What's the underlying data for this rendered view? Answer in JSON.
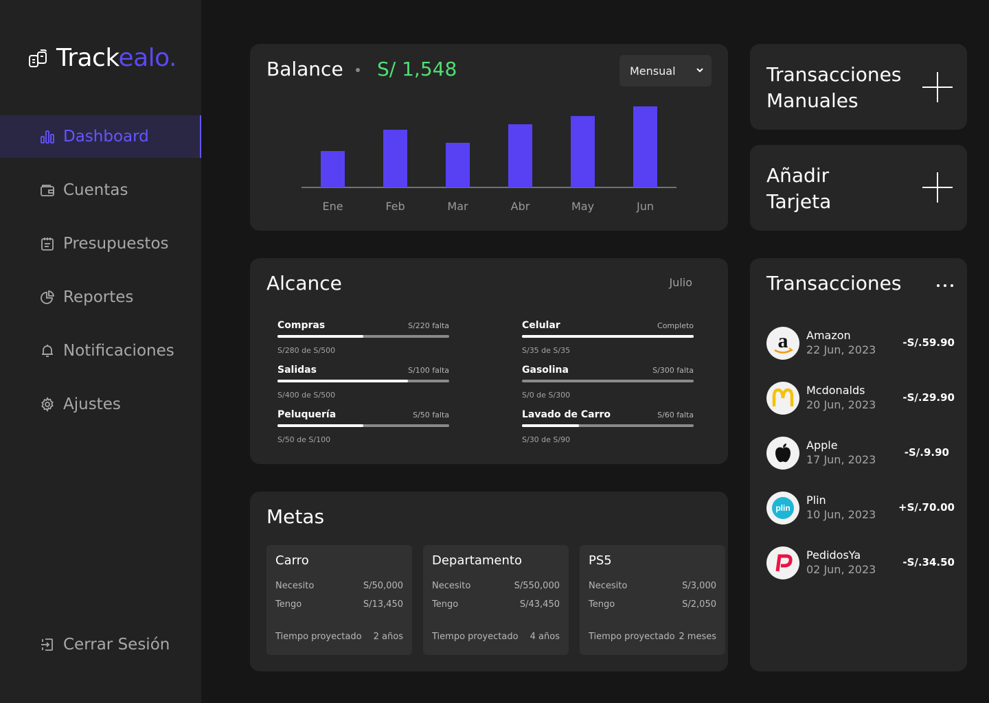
{
  "app": {
    "brand_main": "Track",
    "brand_accent": "ealo."
  },
  "sidebar": {
    "items": [
      {
        "label": "Dashboard",
        "icon": "bar-chart-icon",
        "active": true
      },
      {
        "label": "Cuentas",
        "icon": "wallet-icon",
        "active": false
      },
      {
        "label": "Presupuestos",
        "icon": "notepad-icon",
        "active": false
      },
      {
        "label": "Reportes",
        "icon": "pie-chart-icon",
        "active": false
      },
      {
        "label": "Notificaciones",
        "icon": "bell-icon",
        "active": false
      },
      {
        "label": "Ajustes",
        "icon": "gear-icon",
        "active": false
      }
    ],
    "logout": "Cerrar Sesión"
  },
  "balance": {
    "title": "Balance",
    "value": "S/ 1,548",
    "period": "Mensual"
  },
  "chart_data": {
    "type": "bar",
    "categories": [
      "Ene",
      "Feb",
      "Mar",
      "Abr",
      "May",
      "Jun"
    ],
    "values": [
      53,
      84,
      65,
      92,
      104,
      118
    ],
    "bar_color": "#5741f3",
    "ylim": [
      0,
      130
    ],
    "grid": false
  },
  "alcance": {
    "title": "Alcance",
    "month": "Julio",
    "items": [
      {
        "name": "Compras",
        "remaining": "S/220 falta",
        "detail": "S/280 de S/500",
        "progress": 0.5
      },
      {
        "name": "Celular",
        "remaining": "Completo",
        "detail": "S/35 de S/35",
        "progress": 1.0
      },
      {
        "name": "Salidas",
        "remaining": "S/100 falta",
        "detail": "S/400 de S/500",
        "progress": 0.76
      },
      {
        "name": "Gasolina",
        "remaining": "S/300 falta",
        "detail": "S/0 de S/300",
        "progress": 0.0
      },
      {
        "name": "Peluquería",
        "remaining": "S/50 falta",
        "detail": "S/50 de S/100",
        "progress": 0.5
      },
      {
        "name": "Lavado de Carro",
        "remaining": "S/60 falta",
        "detail": "S/30 de S/90",
        "progress": 0.33
      }
    ]
  },
  "metas": {
    "title": "Metas",
    "need_label": "Necesito",
    "have_label": "Tengo",
    "time_label": "Tiempo proyectado",
    "goals": [
      {
        "name": "Carro",
        "need": "S/50,000",
        "have": "S/13,450",
        "time": "2 años"
      },
      {
        "name": "Departamento",
        "need": "S/550,000",
        "have": "S/43,450",
        "time": "4 años"
      },
      {
        "name": "PS5",
        "need": "S/3,000",
        "have": "S/2,050",
        "time": "2 meses"
      }
    ]
  },
  "actions": {
    "manual_line1": "Transacciones",
    "manual_line2": "Manuales",
    "card_line1": "Añadir",
    "card_line2": "Tarjeta"
  },
  "transactions": {
    "title": "Transacciones",
    "items": [
      {
        "name": "Amazon",
        "date": "22 Jun, 2023",
        "amount": "-S/.59.90",
        "logo": "amazon-logo-icon"
      },
      {
        "name": "Mcdonalds",
        "date": "20 Jun, 2023",
        "amount": "-S/.29.90",
        "logo": "mcdonalds-logo-icon"
      },
      {
        "name": "Apple",
        "date": "17 Jun, 2023",
        "amount": "-S/.9.90",
        "logo": "apple-logo-icon"
      },
      {
        "name": "Plin",
        "date": "10 Jun, 2023",
        "amount": "+S/.70.00",
        "logo": "plin-logo-icon"
      },
      {
        "name": "PedidosYa",
        "date": "02 Jun, 2023",
        "amount": "-S/.34.50",
        "logo": "pedidosya-logo-icon"
      }
    ]
  },
  "colors": {
    "accent": "#5b49f5",
    "positive": "#4ee074",
    "background": "#161616",
    "card": "#262626"
  }
}
